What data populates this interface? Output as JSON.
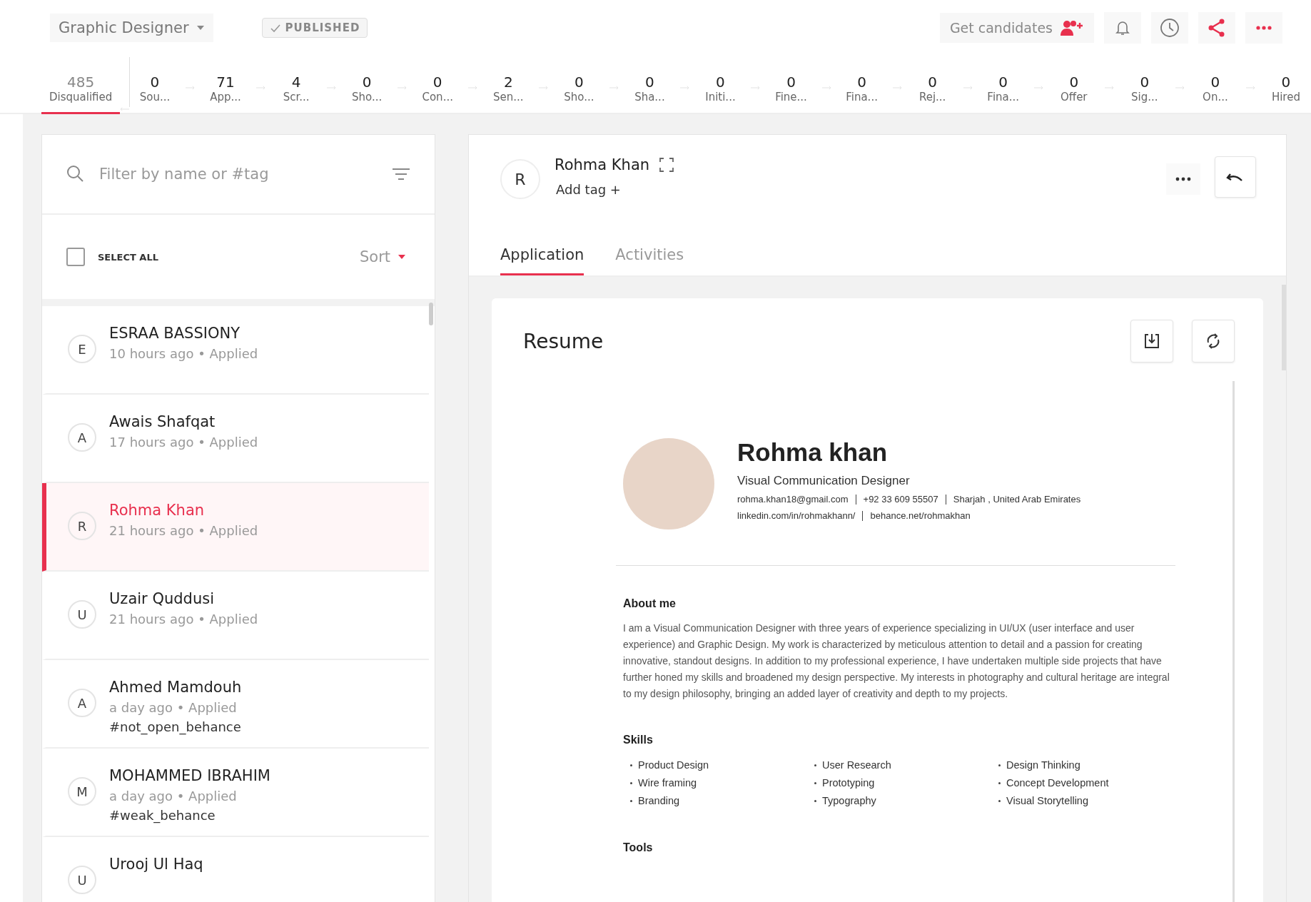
{
  "header": {
    "job_title": "Graphic Designer",
    "status_badge": "PUBLISHED",
    "get_candidates": "Get candidates"
  },
  "pipeline": [
    {
      "count": "485",
      "label": "Disqualified",
      "selected": true
    },
    {
      "count": "0",
      "label": "Sou...",
      "selected": false
    },
    {
      "count": "71",
      "label": "App...",
      "selected": false
    },
    {
      "count": "4",
      "label": "Scr...",
      "selected": false
    },
    {
      "count": "0",
      "label": "Sho...",
      "selected": false
    },
    {
      "count": "0",
      "label": "Con...",
      "selected": false
    },
    {
      "count": "2",
      "label": "Sen...",
      "selected": false
    },
    {
      "count": "0",
      "label": "Sho...",
      "selected": false
    },
    {
      "count": "0",
      "label": "Sha...",
      "selected": false
    },
    {
      "count": "0",
      "label": "Initi...",
      "selected": false
    },
    {
      "count": "0",
      "label": "Fine...",
      "selected": false
    },
    {
      "count": "0",
      "label": "Fina...",
      "selected": false
    },
    {
      "count": "0",
      "label": "Rej...",
      "selected": false
    },
    {
      "count": "0",
      "label": "Fina...",
      "selected": false
    },
    {
      "count": "0",
      "label": "Offer",
      "selected": false
    },
    {
      "count": "0",
      "label": "Sig...",
      "selected": false
    },
    {
      "count": "0",
      "label": "On...",
      "selected": false
    },
    {
      "count": "0",
      "label": "Hired",
      "selected": false
    }
  ],
  "candidate_list": {
    "search": {
      "placeholder": "Filter by name or #tag"
    },
    "select_all": {
      "label": "SELECT ALL",
      "checked": false
    },
    "sort": "Sort",
    "candidates": [
      {
        "initial": "E",
        "name": "ESRAA BASSIONY",
        "meta": "10 hours ago • Applied",
        "selected": false
      },
      {
        "initial": "A",
        "name": "Awais Shafqat",
        "meta": "17 hours ago • Applied",
        "selected": false
      },
      {
        "initial": "R",
        "name": "Rohma Khan",
        "meta": "21 hours ago • Applied",
        "selected": true
      },
      {
        "initial": "U",
        "name": "Uzair Quddusi",
        "meta": "21 hours ago • Applied",
        "selected": false
      },
      {
        "initial": "A",
        "name": "Ahmed Mamdouh",
        "meta": "a day ago • Applied",
        "tag": "#not_open_behance",
        "selected": false
      },
      {
        "initial": "M",
        "name": "MOHAMMED IBRAHIM",
        "meta": "a day ago • Applied",
        "tag": "#weak_behance",
        "selected": false
      },
      {
        "initial": "U",
        "name": "Urooj Ul Haq",
        "selected": false
      }
    ]
  },
  "detail": {
    "initial": "R",
    "name": "Rohma Khan",
    "add_tag": "Add tag +",
    "tabs": [
      {
        "label": "Application",
        "selected": true
      },
      {
        "label": "Activities",
        "selected": false
      }
    ],
    "resume": {
      "title": "Resume",
      "name": "Rohma khan",
      "role": "Visual Communication Designer",
      "contact_lines": [
        [
          "rohma.khan18@gmail.com",
          "+92 33 609 55507",
          "Sharjah , United Arab Emirates"
        ],
        [
          "linkedin.com/in/rohmakhann/",
          "behance.net/rohmakhan"
        ]
      ],
      "sections": [
        {
          "kind": "paragraph",
          "heading": "About me",
          "text": "I am a Visual Communication Designer with three years of experience specializing in UI/UX (user interface and user experience) and Graphic Design. My work is characterized by meticulous attention to detail and a passion for creating innovative, standout designs. In addition to my professional experience, I have undertaken multiple side projects that have further honed my skills and broadened my design perspective. My interests in photography and cultural heritage are integral to my design philosophy, bringing an added layer of creativity and depth to my projects."
        },
        {
          "kind": "columns",
          "heading": "Skills",
          "columns": [
            [
              "Product Design",
              "Wire framing",
              "Branding"
            ],
            [
              "User Research",
              "Prototyping",
              "Typography"
            ],
            [
              "Design Thinking",
              "Concept Development",
              "Visual Storytelling"
            ]
          ]
        },
        {
          "kind": "heading",
          "heading": "Tools"
        }
      ]
    }
  }
}
